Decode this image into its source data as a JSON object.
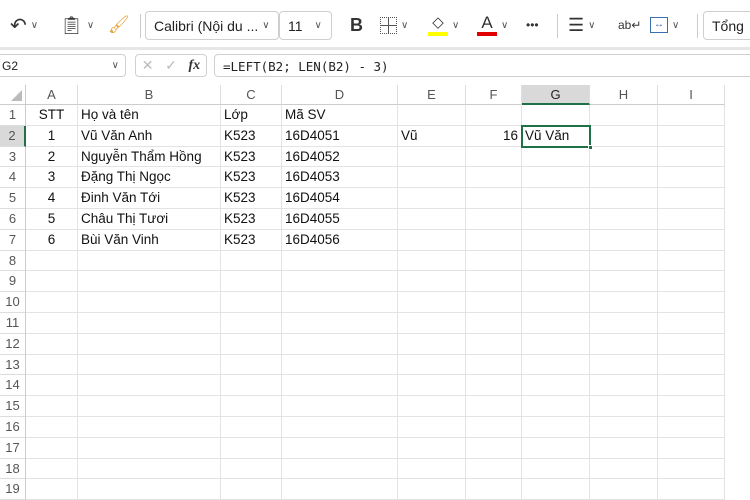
{
  "toolbar": {
    "font_name": "Calibri (Nội du ...",
    "font_size": "11",
    "bold": "B",
    "more": "•••",
    "sum_label": "Tổng",
    "fill_color": "#ffff00",
    "font_color": "#e00000"
  },
  "formula_bar": {
    "name_box": "G2",
    "formula": "=LEFT(B2; LEN(B2) - 3)",
    "fx": "fx"
  },
  "columns": [
    "A",
    "B",
    "C",
    "D",
    "E",
    "F",
    "G",
    "H",
    "I"
  ],
  "selected_column": "G",
  "selected_row": 2,
  "row_count": 19,
  "rows": [
    [
      "STT",
      "Họ và tên",
      "Lớp",
      "Mã SV",
      "",
      "",
      "",
      "",
      ""
    ],
    [
      "1",
      "Vũ Văn Anh",
      "K523",
      "16D4051",
      "Vũ",
      "16",
      "Vũ Văn",
      "",
      ""
    ],
    [
      "2",
      "Nguyễn Thẩm Hồng",
      "K523",
      "16D4052",
      "",
      "",
      "",
      "",
      ""
    ],
    [
      "3",
      "Đặng Thị Ngọc",
      "K523",
      "16D4053",
      "",
      "",
      "",
      "",
      ""
    ],
    [
      "4",
      "Đinh Văn Tới",
      "K523",
      "16D4054",
      "",
      "",
      "",
      "",
      ""
    ],
    [
      "5",
      "Châu Thị Tươi",
      "K523",
      "16D4055",
      "",
      "",
      "",
      "",
      ""
    ],
    [
      "6",
      "Bùi Văn Vinh",
      "K523",
      "16D4056",
      "",
      "",
      "",
      "",
      ""
    ]
  ]
}
